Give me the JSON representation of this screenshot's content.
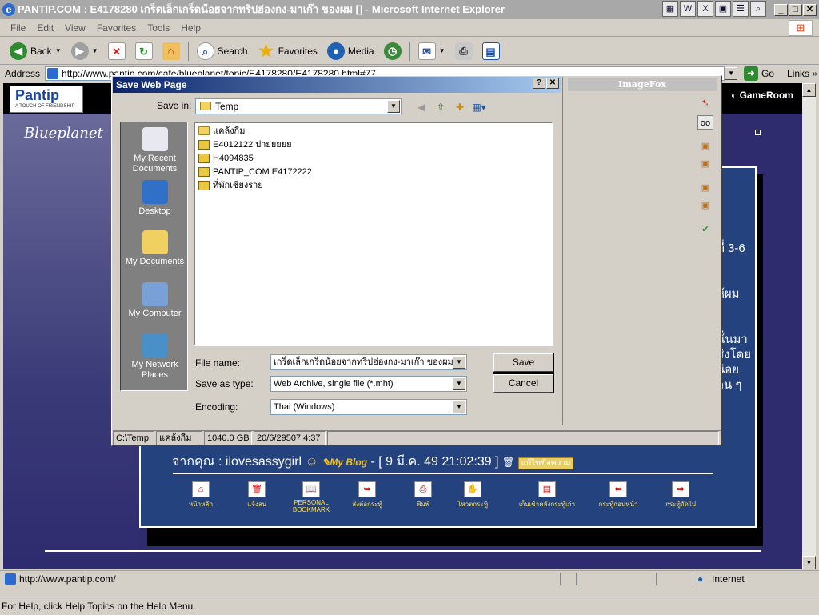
{
  "window": {
    "title": "PANTIP.COM : E4178280 เกร็ดเล็กเกร็ดน้อยจากทริปฮ่องกง-มาเก๊า ของผม [] - Microsoft Internet Explorer"
  },
  "menu": [
    "File",
    "Edit",
    "View",
    "Favorites",
    "Tools",
    "Help"
  ],
  "toolbar": {
    "back": "Back",
    "search": "Search",
    "favorites": "Favorites",
    "media": "Media"
  },
  "address": {
    "label": "Address",
    "url": "http://www.pantip.com/cafe/blueplanet/topic/E4178280/E4178280.html#77",
    "go": "Go",
    "links": "Links"
  },
  "page": {
    "logo": "Pantip",
    "logo_tagline": "A TOUCH OF FRIENDSHIP",
    "nav_left": "g",
    "gameroom": "GameRoom",
    "blueplanet": "Blueplanet",
    "side_text": [
      "ที่ 3-6",
      "ห้ผม",
      "นั่นมา",
      "ส่งโดย",
      "น่อย",
      "อน ๆ"
    ],
    "from_prefix": "จากคุณ : ilovesassygirl",
    "myblog": "My Blog",
    "post_date": "- [ 9 มี.ค. 49 21:02:39 ]",
    "edit_label": "แก้ไขข้อความ",
    "nav_items": [
      "หน้าหลัก",
      "แจ้งลบ",
      "PERSONAL BOOKMARK",
      "ส่งต่อกระทู้",
      "พิมพ์",
      "โหวตกระทู้",
      "เก็บเข้าคลังกระทู้เก่า",
      "กระทู้ก่อนหน้า",
      "กระทู้ถัดไป"
    ]
  },
  "dialog": {
    "title": "Save Web Page",
    "save_in_label": "Save in:",
    "save_in_value": "Temp",
    "places": [
      "My Recent Documents",
      "Desktop",
      "My Documents",
      "My Computer",
      "My Network Places"
    ],
    "files": [
      "แคล้งกีม",
      "E4012122 ปายยยยย",
      "H4094835",
      "PANTIP_COM  E4172222",
      "ที่พักเชียงราย"
    ],
    "file_name_label": "File name:",
    "file_name_value": "เกร็ดเล็กเกร็ดน้อยจากทริปฮ่องกง-มาเก๊า ของผม[",
    "save_type_label": "Save as type:",
    "save_type_value": "Web Archive, single file (*.mht)",
    "encoding_label": "Encoding:",
    "encoding_value": "Thai (Windows)",
    "save_button": "Save",
    "cancel_button": "Cancel",
    "status": [
      "C:\\Temp",
      "แคล้งกีม",
      "1040.0 GB",
      "20/6/29507 4:37"
    ]
  },
  "imagefox": {
    "title": "ImageFox"
  },
  "statusbar": {
    "url": "http://www.pantip.com/",
    "zone": "Internet",
    "help": "For Help, click Help Topics on the Help Menu."
  }
}
